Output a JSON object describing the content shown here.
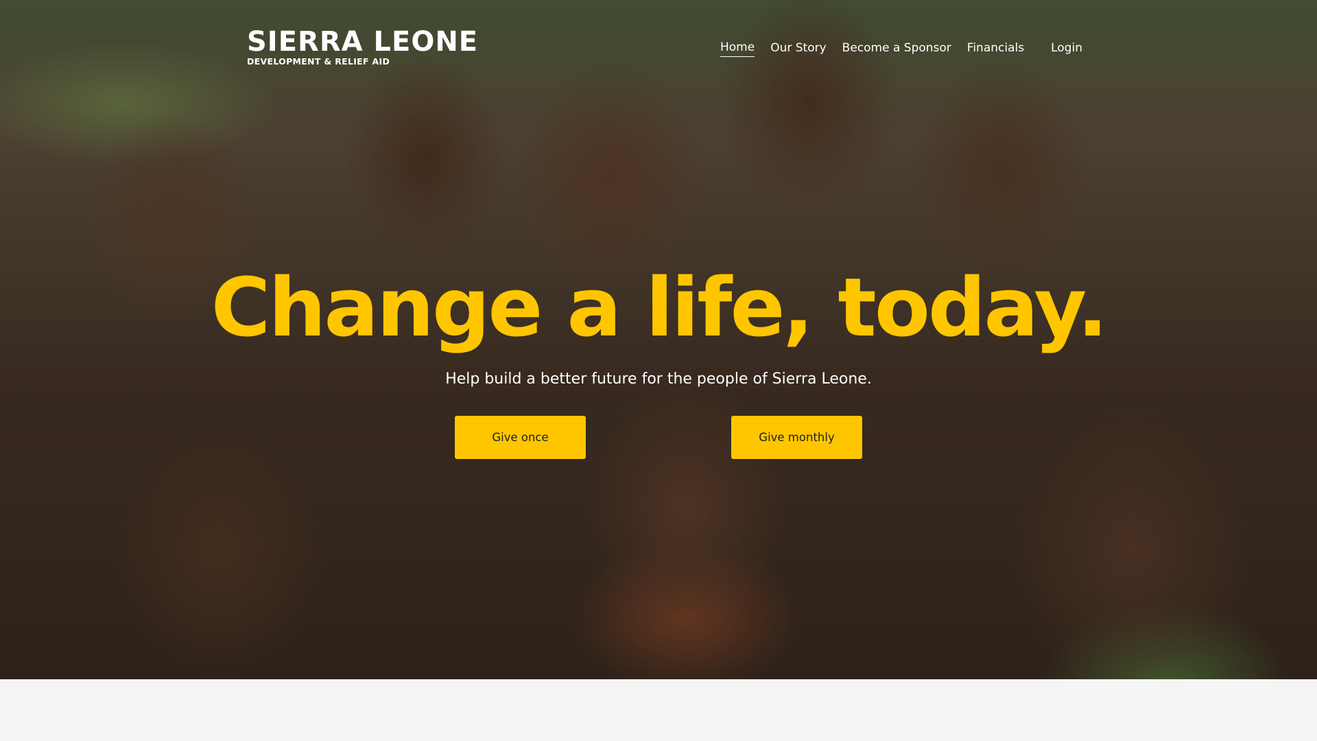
{
  "brand": {
    "title": "SIERRA LEONE",
    "subtitle": "DEVELOPMENT & RELIEF AID"
  },
  "nav": {
    "items": [
      {
        "label": "Home",
        "active": true
      },
      {
        "label": "Our Story",
        "active": false
      },
      {
        "label": "Become a Sponsor",
        "active": false
      },
      {
        "label": "Financials",
        "active": false
      }
    ],
    "login_label": "Login"
  },
  "hero": {
    "headline": "Change a life, today.",
    "subheadline": "Help build a better future for the people of Sierra Leone.",
    "buttons": {
      "give_once": "Give once",
      "give_monthly": "Give monthly"
    },
    "image": "children-waving-photo"
  },
  "colors": {
    "accent": "#ffc600",
    "nav_text": "#ffffff",
    "footer_bg": "#f5f5f5"
  }
}
